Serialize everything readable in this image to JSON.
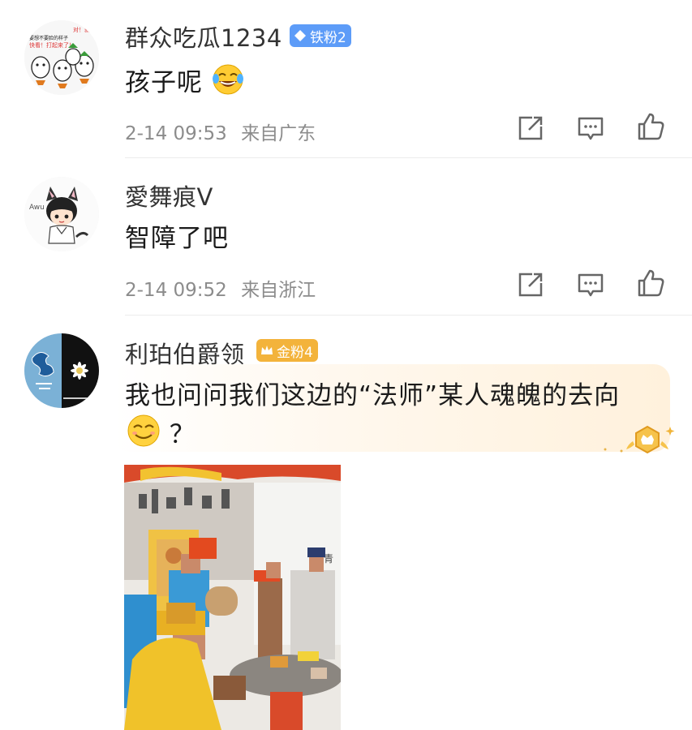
{
  "comments": [
    {
      "username": "群众吃瓜1234",
      "badge": {
        "label": "铁粉2",
        "color": "#5d9cf8"
      },
      "text": "孩子呢",
      "emoji": "laughing-crying-emoji",
      "date": "2-14 09:53",
      "location": "来自广东",
      "avatar_text": {
        "line1": "对！就是这样",
        "line2": "要想不要脸的样子",
        "line3": "快看！打起来了！"
      }
    },
    {
      "username": "愛舞痕V",
      "text": "智障了吧",
      "date": "2-14 09:52",
      "location": "来自浙江",
      "avatar_text": {
        "line1": "Awu"
      }
    },
    {
      "username": "利珀伯爵领",
      "badge": {
        "label": "金粉4",
        "color": "#f3b33b"
      },
      "text": "我也问问我们这边的“法师”某人魂魄的去向",
      "text_line2": "？",
      "emoji": "smiling-emoji"
    }
  ],
  "icons": [
    "share-icon",
    "comment-icon",
    "like-icon"
  ],
  "colors": {
    "divider": "#ececec",
    "meta": "#8c8c8c",
    "highlight": "#fff1dc"
  }
}
